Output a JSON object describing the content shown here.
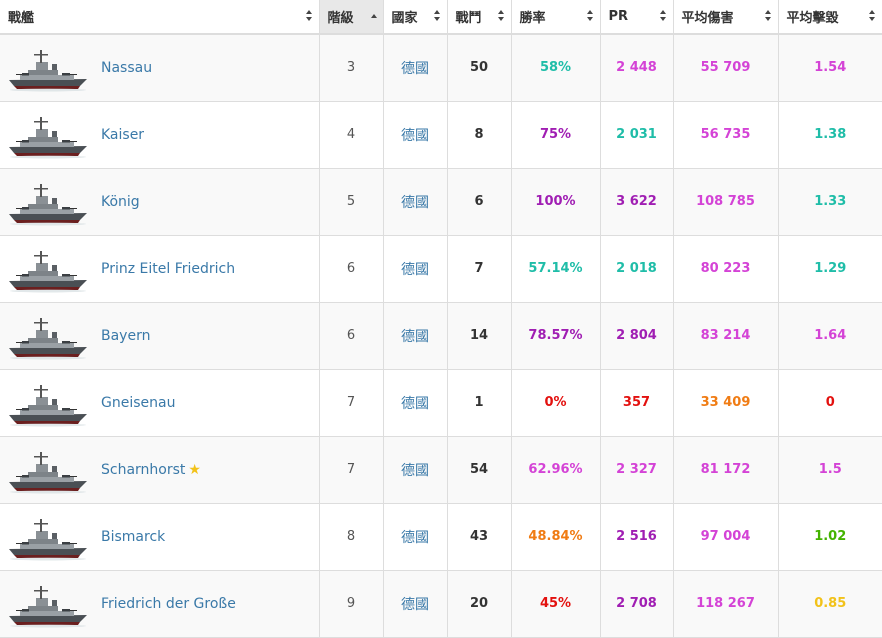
{
  "columns": [
    {
      "key": "ship",
      "label": "戰艦",
      "sort": "both"
    },
    {
      "key": "tier",
      "label": "階級",
      "sort": "asc"
    },
    {
      "key": "nation",
      "label": "國家",
      "sort": "both"
    },
    {
      "key": "battles",
      "label": "戰鬥",
      "sort": "both"
    },
    {
      "key": "winrate",
      "label": "勝率",
      "sort": "both"
    },
    {
      "key": "pr",
      "label": "PR",
      "sort": "both"
    },
    {
      "key": "avg_damage",
      "label": "平均傷害",
      "sort": "both"
    },
    {
      "key": "avg_kills",
      "label": "平均擊毀",
      "sort": "both"
    }
  ],
  "colors": {
    "teal": "#1fbda8",
    "purple": "#a01eb3",
    "magenta": "#d443d6",
    "red": "#e3110f",
    "orange": "#f07c14",
    "green": "#44b300",
    "yellow": "#f2c21a",
    "link": "#3a79a8"
  },
  "rows": [
    {
      "ship": "Nassau",
      "star": false,
      "tier": "3",
      "nation": "德國",
      "battles": "50",
      "winrate": {
        "text": "58%",
        "color": "#1fbda8"
      },
      "pr": {
        "text": "2 448",
        "color": "#d443d6"
      },
      "avg_damage": {
        "text": "55 709",
        "color": "#d443d6"
      },
      "avg_kills": {
        "text": "1.54",
        "color": "#d443d6"
      }
    },
    {
      "ship": "Kaiser",
      "star": false,
      "tier": "4",
      "nation": "德國",
      "battles": "8",
      "winrate": {
        "text": "75%",
        "color": "#a01eb3"
      },
      "pr": {
        "text": "2 031",
        "color": "#1fbda8"
      },
      "avg_damage": {
        "text": "56 735",
        "color": "#d443d6"
      },
      "avg_kills": {
        "text": "1.38",
        "color": "#1fbda8"
      }
    },
    {
      "ship": "König",
      "star": false,
      "tier": "5",
      "nation": "德國",
      "battles": "6",
      "winrate": {
        "text": "100%",
        "color": "#a01eb3"
      },
      "pr": {
        "text": "3 622",
        "color": "#a01eb3"
      },
      "avg_damage": {
        "text": "108 785",
        "color": "#d443d6"
      },
      "avg_kills": {
        "text": "1.33",
        "color": "#1fbda8"
      }
    },
    {
      "ship": "Prinz Eitel Friedrich",
      "star": false,
      "tier": "6",
      "nation": "德國",
      "battles": "7",
      "winrate": {
        "text": "57.14%",
        "color": "#1fbda8"
      },
      "pr": {
        "text": "2 018",
        "color": "#1fbda8"
      },
      "avg_damage": {
        "text": "80 223",
        "color": "#d443d6"
      },
      "avg_kills": {
        "text": "1.29",
        "color": "#1fbda8"
      }
    },
    {
      "ship": "Bayern",
      "star": false,
      "tier": "6",
      "nation": "德國",
      "battles": "14",
      "winrate": {
        "text": "78.57%",
        "color": "#a01eb3"
      },
      "pr": {
        "text": "2 804",
        "color": "#a01eb3"
      },
      "avg_damage": {
        "text": "83 214",
        "color": "#d443d6"
      },
      "avg_kills": {
        "text": "1.64",
        "color": "#d443d6"
      }
    },
    {
      "ship": "Gneisenau",
      "star": false,
      "tier": "7",
      "nation": "德國",
      "battles": "1",
      "winrate": {
        "text": "0%",
        "color": "#e3110f"
      },
      "pr": {
        "text": "357",
        "color": "#e3110f"
      },
      "avg_damage": {
        "text": "33 409",
        "color": "#f07c14"
      },
      "avg_kills": {
        "text": "0",
        "color": "#e3110f"
      }
    },
    {
      "ship": "Scharnhorst",
      "star": true,
      "tier": "7",
      "nation": "德國",
      "battles": "54",
      "winrate": {
        "text": "62.96%",
        "color": "#d443d6"
      },
      "pr": {
        "text": "2 327",
        "color": "#d443d6"
      },
      "avg_damage": {
        "text": "81 172",
        "color": "#d443d6"
      },
      "avg_kills": {
        "text": "1.5",
        "color": "#d443d6"
      }
    },
    {
      "ship": "Bismarck",
      "star": false,
      "tier": "8",
      "nation": "德國",
      "battles": "43",
      "winrate": {
        "text": "48.84%",
        "color": "#f07c14"
      },
      "pr": {
        "text": "2 516",
        "color": "#a01eb3"
      },
      "avg_damage": {
        "text": "97 004",
        "color": "#d443d6"
      },
      "avg_kills": {
        "text": "1.02",
        "color": "#44b300"
      }
    },
    {
      "ship": "Friedrich der Große",
      "star": false,
      "tier": "9",
      "nation": "德國",
      "battles": "20",
      "winrate": {
        "text": "45%",
        "color": "#e3110f"
      },
      "pr": {
        "text": "2 708",
        "color": "#a01eb3"
      },
      "avg_damage": {
        "text": "118 267",
        "color": "#d443d6"
      },
      "avg_kills": {
        "text": "0.85",
        "color": "#f2c21a"
      }
    }
  ]
}
